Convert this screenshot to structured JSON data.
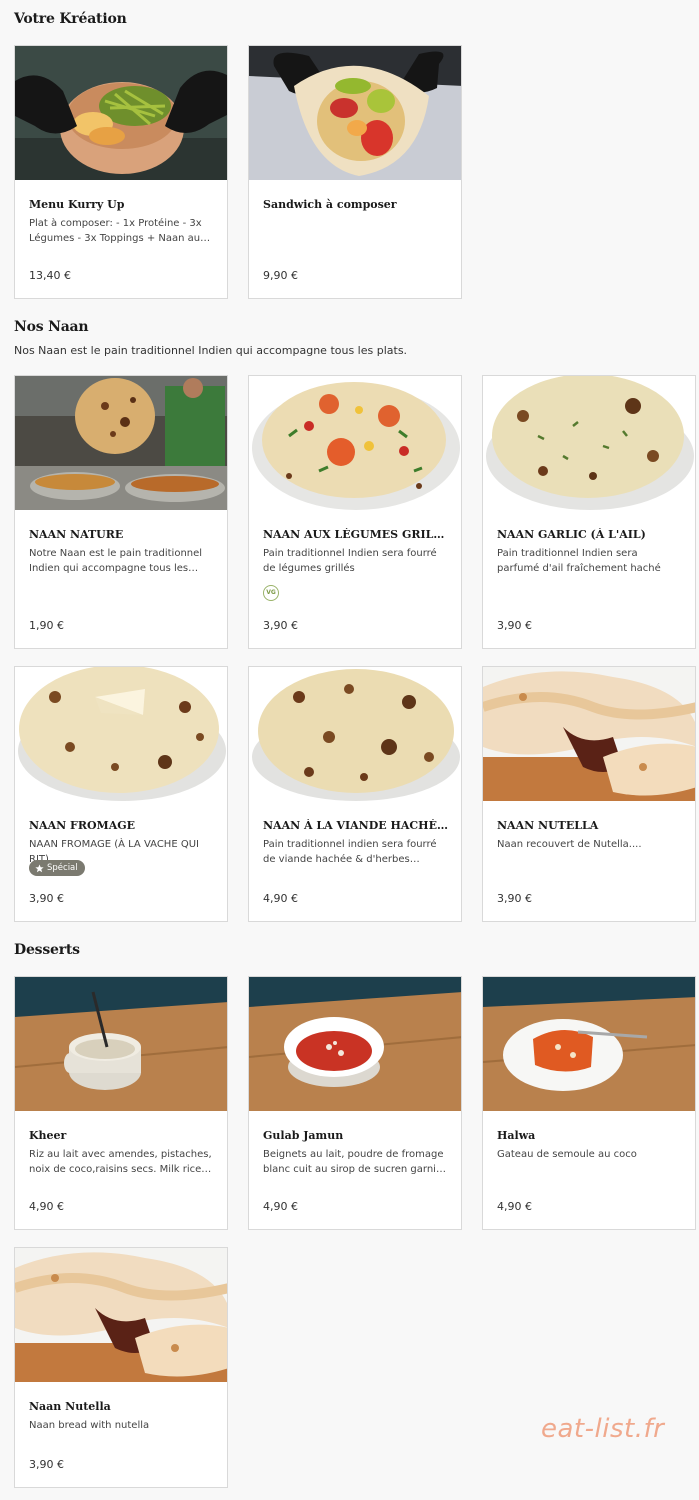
{
  "sections": {
    "creation": {
      "title": "Votre Kréation"
    },
    "naan": {
      "title": "Nos Naan",
      "description": "Nos Naan est le pain traditionnel Indien qui accompagne tous les plats."
    },
    "desserts": {
      "title": "Desserts"
    }
  },
  "cards": {
    "menu_kurry": {
      "title": "Menu Kurry Up",
      "description": "Plat à composer: - 1x Protéine - 3x Légumes - 3x Toppings + Naan au choix",
      "price": "13,40 €"
    },
    "sandwich": {
      "title": "Sandwich à composer",
      "price": "9,90 €"
    },
    "naan_nature": {
      "title": "NAAN NATURE",
      "description": "Notre Naan est le pain traditionnel Indien qui accompagne tous les plats. Il est",
      "price": "1,90 €"
    },
    "naan_legumes": {
      "title": "NAAN AUX LÉGUMES GRILLÉS",
      "description": "Pain traditionnel Indien sera fourré de légumes grillés",
      "badge": "VG",
      "price": "3,90 €"
    },
    "naan_garlic": {
      "title": "NAAN GARLIC (À L'AIL)",
      "description": "Pain traditionnel Indien sera parfumé d'ail fraîchement haché",
      "price": "3,90 €"
    },
    "naan_fromage": {
      "title": "NAAN FROMAGE",
      "description": "NAAN FROMAGE (À LA VACHE QUI RIT)",
      "badge": "Spécial",
      "price": "3,90 €"
    },
    "naan_viande": {
      "title": "NAAN À LA VIANDE HACHÉE & AUX HERBES",
      "description": "Pain traditionnel indien sera fourré de viande hachée & d'herbes indiennes",
      "price": "4,90 €"
    },
    "naan_nutella_1": {
      "title": "NAAN NUTELLA",
      "description": "Naan recouvert de Nutella....",
      "price": "3,90 €"
    },
    "kheer": {
      "title": "Kheer",
      "description": "Riz au lait avec amendes, pistaches, noix de coco,raisins secs. Milk rice with almonds",
      "price": "4,90 €"
    },
    "gulab": {
      "title": "Gulab Jamun",
      "description": "Beignets au lait, poudre de fromage blanc cuit au sirop de sucren garni avec",
      "price": "4,90 €"
    },
    "halwa": {
      "title": "Halwa",
      "description": "Gateau de semoule au coco",
      "price": "4,90 €"
    },
    "naan_nutella_2": {
      "title": "Naan Nutella",
      "description": "Naan bread with nutella",
      "price": "3,90 €"
    }
  },
  "icons": {
    "vg": "vegetarian-badge-icon",
    "star": "star-icon"
  },
  "colors": {
    "background": "#f8f8f8",
    "special_badge": "#7b7a70",
    "vg_badge": "#9ab36a",
    "watermark": "#f0a98d"
  },
  "watermark": "eat-list.fr"
}
